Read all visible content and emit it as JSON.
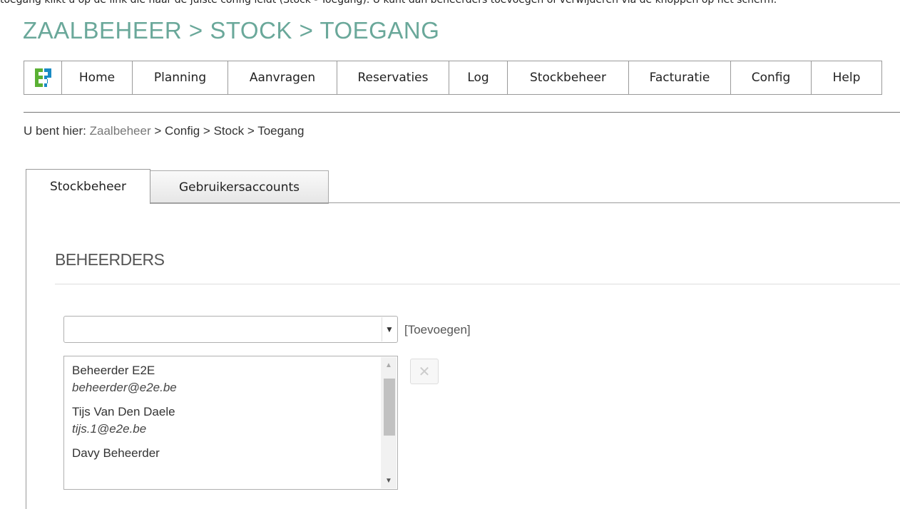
{
  "top_text": "toegang klikt u op de link die naar de juiste config leidt (Stock - Toegang). U kunt dan beheerders toevoegen of verwijderen via de knoppen op het scherm.",
  "page_title": "ZAALBEHEER > STOCK > TOEGANG",
  "nav": {
    "logo": "e2e-logo",
    "items": [
      {
        "label": "Home"
      },
      {
        "label": "Planning"
      },
      {
        "label": "Aanvragen"
      },
      {
        "label": "Reservaties"
      },
      {
        "label": "Log"
      },
      {
        "label": "Stockbeheer"
      },
      {
        "label": "Facturatie"
      },
      {
        "label": "Config"
      },
      {
        "label": "Help"
      }
    ]
  },
  "breadcrumb": {
    "prefix": "U bent hier:",
    "items": [
      "Zaalbeheer",
      "Config",
      "Stock",
      "Toegang"
    ],
    "separator": ">"
  },
  "tabs": [
    {
      "label": "Stockbeheer",
      "active": true
    },
    {
      "label": "Gebruikersaccounts",
      "active": false
    }
  ],
  "section": {
    "title": "BEHEERDERS",
    "select": {
      "value": "",
      "arrow_icon": "dropdown-arrow-icon"
    },
    "add_label": "[Toevoegen]",
    "delete_icon": "close-icon",
    "users": [
      {
        "name": "Beheerder E2E",
        "email": "beheerder@e2e.be"
      },
      {
        "name": "Tijs Van Den Daele",
        "email": "tijs.1@e2e.be"
      },
      {
        "name": "Davy Beheerder",
        "email": ""
      }
    ]
  },
  "colors": {
    "title": "#6aa89a",
    "logo_green": "#5ab034",
    "logo_blue": "#1a8bc4"
  }
}
